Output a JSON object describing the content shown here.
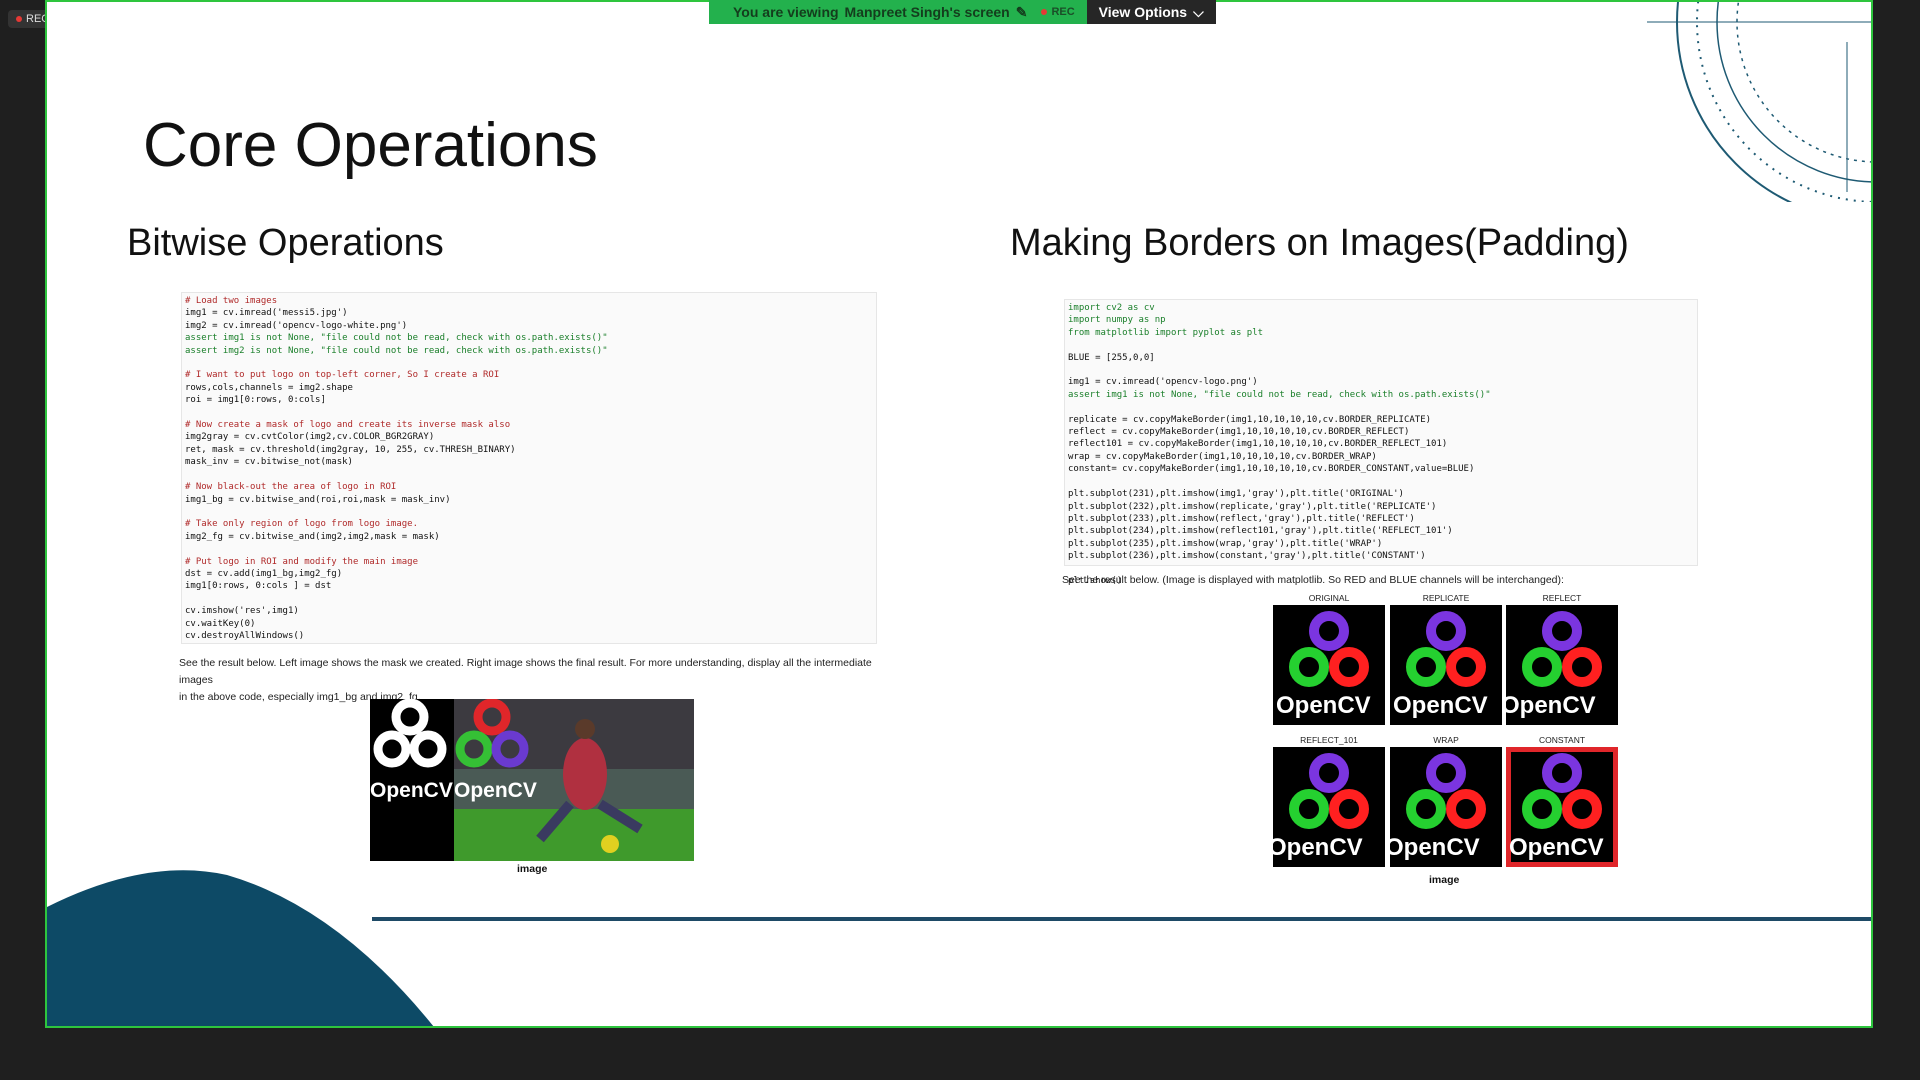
{
  "rec_indicator": "REC",
  "banner": {
    "viewing_text": "You are viewing",
    "presenter": "Manpreet Singh's screen",
    "rec_label": "REC",
    "view_options": "View Options"
  },
  "slide": {
    "title": "Core Operations",
    "left": {
      "heading": "Bitwise Operations",
      "code_lines": [
        "# Load two images",
        "img1 = cv.imread('messi5.jpg')",
        "img2 = cv.imread('opencv-logo-white.png')",
        "assert img1 is not None, \"file could not be read, check with os.path.exists()\"",
        "assert img2 is not None, \"file could not be read, check with os.path.exists()\"",
        "",
        "# I want to put logo on top-left corner, So I create a ROI",
        "rows,cols,channels = img2.shape",
        "roi = img1[0:rows, 0:cols]",
        "",
        "# Now create a mask of logo and create its inverse mask also",
        "img2gray = cv.cvtColor(img2,cv.COLOR_BGR2GRAY)",
        "ret, mask = cv.threshold(img2gray, 10, 255, cv.THRESH_BINARY)",
        "mask_inv = cv.bitwise_not(mask)",
        "",
        "# Now black-out the area of logo in ROI",
        "img1_bg = cv.bitwise_and(roi,roi,mask = mask_inv)",
        "",
        "# Take only region of logo from logo image.",
        "img2_fg = cv.bitwise_and(img2,img2,mask = mask)",
        "",
        "# Put logo in ROI and modify the main image",
        "dst = cv.add(img1_bg,img2_fg)",
        "img1[0:rows, 0:cols ] = dst",
        "",
        "cv.imshow('res',img1)",
        "cv.waitKey(0)",
        "cv.destroyAllWindows()"
      ],
      "caption_line1": "See the result below. Left image shows the mask we created. Right image shows the final result. For more understanding, display all the intermediate images",
      "caption_line2": "in the above code, especially img1_bg and img2_fg.",
      "image_caption": "image",
      "logo_text": "OpenCV"
    },
    "right": {
      "heading": "Making Borders on Images(Padding)",
      "code_lines": [
        "import cv2 as cv",
        "import numpy as np",
        "from matplotlib import pyplot as plt",
        "",
        "BLUE = [255,0,0]",
        "",
        "img1 = cv.imread('opencv-logo.png')",
        "assert img1 is not None, \"file could not be read, check with os.path.exists()\"",
        "",
        "replicate = cv.copyMakeBorder(img1,10,10,10,10,cv.BORDER_REPLICATE)",
        "reflect = cv.copyMakeBorder(img1,10,10,10,10,cv.BORDER_REFLECT)",
        "reflect101 = cv.copyMakeBorder(img1,10,10,10,10,cv.BORDER_REFLECT_101)",
        "wrap = cv.copyMakeBorder(img1,10,10,10,10,cv.BORDER_WRAP)",
        "constant= cv.copyMakeBorder(img1,10,10,10,10,cv.BORDER_CONSTANT,value=BLUE)",
        "",
        "plt.subplot(231),plt.imshow(img1,'gray'),plt.title('ORIGINAL')",
        "plt.subplot(232),plt.imshow(replicate,'gray'),plt.title('REPLICATE')",
        "plt.subplot(233),plt.imshow(reflect,'gray'),plt.title('REFLECT')",
        "plt.subplot(234),plt.imshow(reflect101,'gray'),plt.title('REFLECT_101')",
        "plt.subplot(235),plt.imshow(wrap,'gray'),plt.title('WRAP')",
        "plt.subplot(236),plt.imshow(constant,'gray'),plt.title('CONSTANT')",
        "",
        "plt.show()"
      ],
      "caption": "See the result below. (Image is displayed with matplotlib. So RED and BLUE channels will be interchanged):",
      "panel_titles": [
        "ORIGINAL",
        "REPLICATE",
        "REFLECT",
        "REFLECT_101",
        "WRAP",
        "CONSTANT"
      ],
      "image_caption": "image",
      "logo_text": "OpenCV"
    }
  },
  "colors": {
    "accent_green": "#23b14d",
    "slide_border": "#2ec53e",
    "decor_blue": "#0d4a66",
    "comment": "#b02a2a",
    "keyword": "#1a7f2a",
    "string": "#7a2aa0"
  }
}
